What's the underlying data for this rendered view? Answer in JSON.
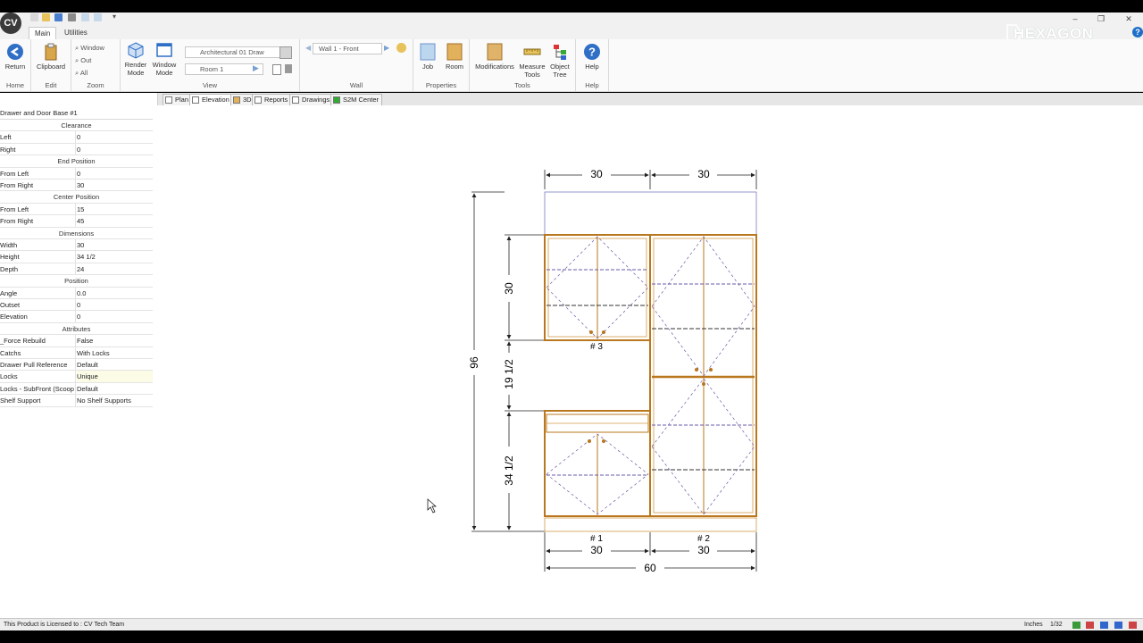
{
  "app": {
    "logo": "CV",
    "brand": "HEXAGON"
  },
  "ribbon_tabs": [
    "Main",
    "Utilities"
  ],
  "window_controls": {
    "minimize": "–",
    "restore": "❐",
    "close": "✕"
  },
  "help_icon": "?",
  "ribbon": {
    "home": {
      "return_label": "Return",
      "group": "Home"
    },
    "edit": {
      "clipboard_label": "Clipboard",
      "group": "Edit"
    },
    "zoom": {
      "window": "Window",
      "out": "Out",
      "all": "All",
      "group": "Zoom"
    },
    "view": {
      "render_mode": "Render Mode",
      "window_mode": "Window Mode",
      "drawing_combo": "Architectural 01 Draw",
      "room_combo": "Room 1",
      "group": "View"
    },
    "wall": {
      "wall_combo": "Wall 1 - Front",
      "group": "Wall"
    },
    "properties": {
      "job": "Job",
      "room": "Room",
      "group": "Properties"
    },
    "tools": {
      "modifications": "Modifications",
      "measure_tools": "Measure Tools",
      "object_tree": "Object Tree",
      "group": "Tools"
    },
    "help": {
      "help": "Help",
      "group": "Help"
    }
  },
  "doc_tabs": [
    "Plan",
    "Elevation",
    "3D",
    "Reports",
    "Drawings",
    "S2M Center"
  ],
  "properties_panel": {
    "title": "Drawer and Door Base #1",
    "rows": [
      {
        "type": "cat",
        "label": "Clearance"
      },
      {
        "key": "Left",
        "value": "0"
      },
      {
        "key": "Right",
        "value": "0"
      },
      {
        "type": "cat",
        "label": "End Position"
      },
      {
        "key": "From Left",
        "value": "0"
      },
      {
        "key": "From Right",
        "value": "30"
      },
      {
        "type": "cat",
        "label": "Center Position"
      },
      {
        "key": "From Left",
        "value": "15"
      },
      {
        "key": "From Right",
        "value": "45"
      },
      {
        "type": "cat",
        "label": "Dimensions"
      },
      {
        "key": "Width",
        "value": "30"
      },
      {
        "key": "Height",
        "value": "34 1/2"
      },
      {
        "key": "Depth",
        "value": "24"
      },
      {
        "type": "cat",
        "label": "Position"
      },
      {
        "key": "Angle",
        "value": "0.0"
      },
      {
        "key": "Outset",
        "value": "0"
      },
      {
        "key": "Elevation",
        "value": "0"
      },
      {
        "type": "cat",
        "label": "Attributes"
      },
      {
        "key": "_Force Rebuild",
        "value": "False"
      },
      {
        "key": "Catchs",
        "value": "With Locks"
      },
      {
        "key": "Drawer Pull Reference",
        "value": "Default"
      },
      {
        "key": "Locks",
        "value": "Unique",
        "selected": true
      },
      {
        "key": "Locks - SubFront (Scoop c",
        "value": "Default"
      },
      {
        "key": "Shelf Support",
        "value": "No Shelf Supports"
      }
    ]
  },
  "elevation": {
    "top_dims": [
      "30",
      "30"
    ],
    "left_dims": [
      "96",
      "30",
      "19 1/2",
      "34 1/2"
    ],
    "cabinet_labels": [
      "# 3",
      "# 1",
      "# 2"
    ],
    "bottom_dims": [
      "30",
      "30"
    ],
    "total_width": "60"
  },
  "status": {
    "license": "This Product is Licensed to : CV Tech Team",
    "units": "Inches",
    "scale": "1/32"
  },
  "colors": {
    "accent": "#1e6ec8",
    "cabinet": "#b9771e",
    "dashed": "#6a5aa8"
  }
}
